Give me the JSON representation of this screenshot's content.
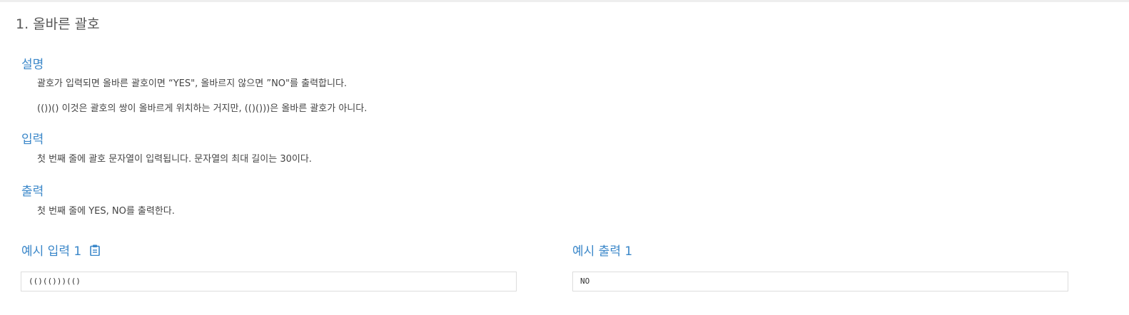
{
  "problem": {
    "title": "1. 올바른 괄호"
  },
  "sections": {
    "description": {
      "heading": "설명",
      "paragraphs": [
        "괄호가 입력되면 올바른 괄호이면 “YES\", 올바르지 않으면 ”NO\"를 출력합니다.",
        "(())() 이것은 괄호의 쌍이 올바르게 위치하는 거지만, (()()))은 올바른 괄호가 아니다."
      ]
    },
    "input": {
      "heading": "입력",
      "text": "첫 번째 줄에 괄호 문자열이 입력됩니다. 문자열의 최대 길이는 30이다."
    },
    "output": {
      "heading": "출력",
      "text": "첫 번째 줄에 YES, NO를 출력한다."
    }
  },
  "examples": {
    "input": {
      "title": "예시 입력 1",
      "value": "(()(()))(()",
      "icon": "clipboard-icon"
    },
    "output": {
      "title": "예시 출력 1",
      "value": "NO"
    }
  },
  "colors": {
    "accent": "#3a87c9",
    "text": "#444444",
    "border": "#dddddd"
  }
}
